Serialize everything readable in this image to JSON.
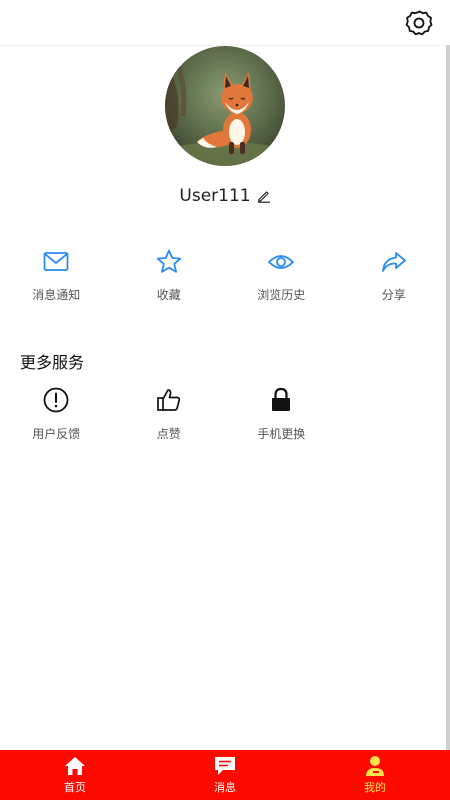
{
  "header": {
    "settings_icon": "gear-icon"
  },
  "profile": {
    "username": "User111",
    "avatar": "fox-illustration"
  },
  "actions": [
    {
      "label": "消息通知",
      "icon": "mail-icon"
    },
    {
      "label": "收藏",
      "icon": "star-icon"
    },
    {
      "label": "浏览历史",
      "icon": "eye-icon"
    },
    {
      "label": "分享",
      "icon": "share-icon"
    }
  ],
  "more_services": {
    "title": "更多服务",
    "items": [
      {
        "label": "用户反馈",
        "icon": "exclamation-icon"
      },
      {
        "label": "点赞",
        "icon": "thumbs-up-icon"
      },
      {
        "label": "手机更换",
        "icon": "lock-icon"
      }
    ]
  },
  "tabbar": {
    "tabs": [
      {
        "label": "首页",
        "icon": "home-icon"
      },
      {
        "label": "消息",
        "icon": "message-icon"
      },
      {
        "label": "我的",
        "icon": "user-icon",
        "active": true
      }
    ]
  },
  "colors": {
    "accent_blue": "#2a8cf0",
    "tabbar_bg": "#fb0a00",
    "tab_active": "#ffe14a"
  }
}
